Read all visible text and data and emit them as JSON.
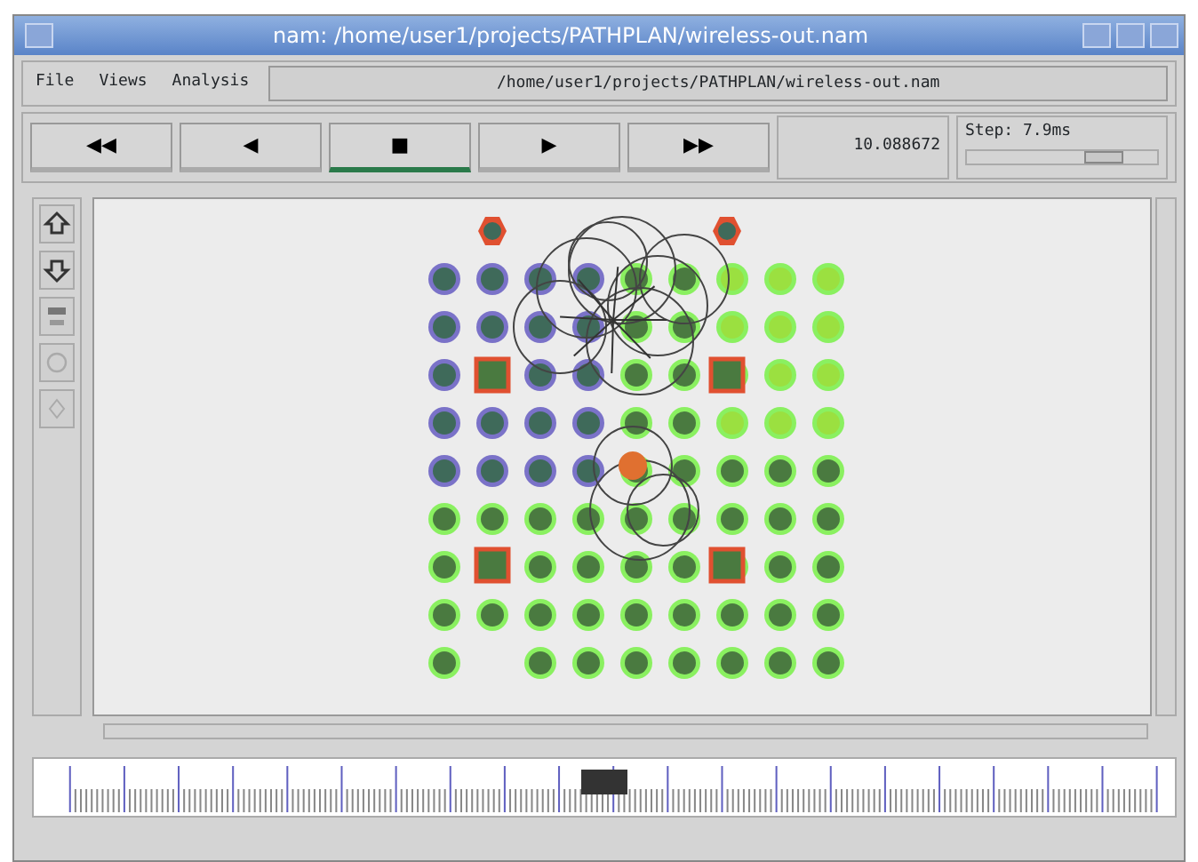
{
  "window": {
    "title": "nam: /home/user1/projects/PATHPLAN/wireless-out.nam"
  },
  "menu": [
    "File",
    "Views",
    "Analysis"
  ],
  "file_path": "/home/user1/projects/PATHPLAN/wireless-out.nam",
  "transport": [
    {
      "label": "◀◀",
      "selected": false
    },
    {
      "label": "◀",
      "selected": false
    },
    {
      "label": "■",
      "selected": true
    },
    {
      "label": "▶",
      "selected": false
    },
    {
      "label": "▶▶",
      "selected": false
    }
  ],
  "time": "10.088672",
  "step": {
    "label": "Step: 7.9ms",
    "level": 0.72
  },
  "timeline": {
    "level": 0.5
  }
}
